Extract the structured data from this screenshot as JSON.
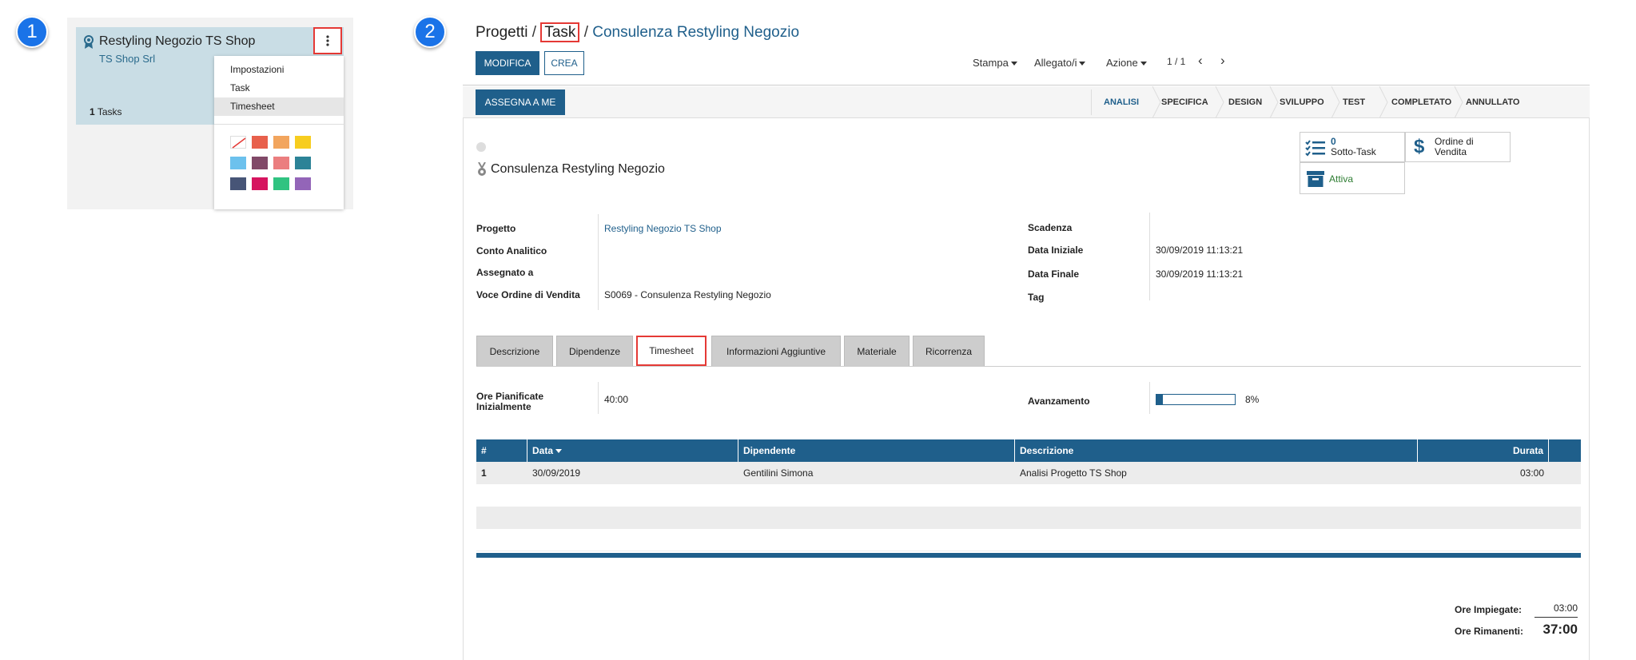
{
  "steps": [
    "1",
    "2"
  ],
  "panel1": {
    "card": {
      "title": "Restyling Negozio TS Shop",
      "company": "TS Shop Srl",
      "tasks_count": "1",
      "tasks_label": "Tasks"
    },
    "menu": {
      "items": [
        "Impostazioni",
        "Task",
        "Timesheet"
      ],
      "active": "Timesheet",
      "colors": [
        "none",
        "#e8604c",
        "#f2a55e",
        "#f7cd1f",
        "#6cc1ed",
        "#814968",
        "#eb7e7f",
        "#2c8397",
        "#475577",
        "#d6145f",
        "#30c381",
        "#9365b8"
      ]
    }
  },
  "panel2": {
    "breadcrumb": {
      "root": "Progetti",
      "middle": "Task",
      "current": "Consulenza Restyling Negozio"
    },
    "buttons": {
      "edit": "MODIFICA",
      "create": "CREA",
      "assign": "ASSEGNA A ME"
    },
    "toolbar": {
      "print": "Stampa",
      "attachments": "Allegato/i",
      "action": "Azione",
      "pager": "1 / 1"
    },
    "stages": [
      "ANALISI",
      "SPECIFICA",
      "DESIGN",
      "SVILUPPO",
      "TEST",
      "COMPLETATO",
      "ANNULLATO"
    ],
    "active_stage": "ANALISI",
    "stat_buttons": {
      "subtasks_count": "0",
      "subtasks_label": "Sotto-Task",
      "sales_order_line1": "Ordine di",
      "sales_order_line2": "Vendita",
      "active_label": "Attiva"
    },
    "record_title": "Consulenza Restyling Negozio",
    "fields_left": [
      {
        "label": "Progetto",
        "value": "Restyling Negozio TS Shop"
      },
      {
        "label": "Conto Analitico",
        "value": ""
      },
      {
        "label": "Assegnato a",
        "value": ""
      },
      {
        "label": "Voce Ordine di Vendita",
        "value": "S0069 - Consulenza Restyling Negozio"
      }
    ],
    "fields_right": [
      {
        "label": "Scadenza",
        "value": ""
      },
      {
        "label": "Data Iniziale",
        "value": "30/09/2019 11:13:21"
      },
      {
        "label": "Data Finale",
        "value": "30/09/2019 11:13:21"
      },
      {
        "label": "Tag",
        "value": ""
      }
    ],
    "tabs": [
      "Descrizione",
      "Dipendenze",
      "Timesheet",
      "Informazioni Aggiuntive",
      "Materiale",
      "Ricorrenza"
    ],
    "active_tab": "Timesheet",
    "planned_hours": {
      "label_line1": "Ore Pianificate",
      "label_line2": "Inizialmente",
      "value": "40:00"
    },
    "progress": {
      "label": "Avanzamento",
      "value_text": "8%",
      "fraction": 0.08
    },
    "timesheet": {
      "columns": [
        "#",
        "Data",
        "Dipendente",
        "Descrizione",
        "Durata"
      ],
      "rows": [
        {
          "num": "1",
          "date": "30/09/2019",
          "employee": "Gentilini Simona",
          "description": "Analisi Progetto TS Shop",
          "duration": "03:00"
        }
      ]
    },
    "totals": {
      "spent_label": "Ore Impiegate:",
      "spent_value": "03:00",
      "remaining_label": "Ore Rimanenti:",
      "remaining_value": "37:00"
    }
  }
}
